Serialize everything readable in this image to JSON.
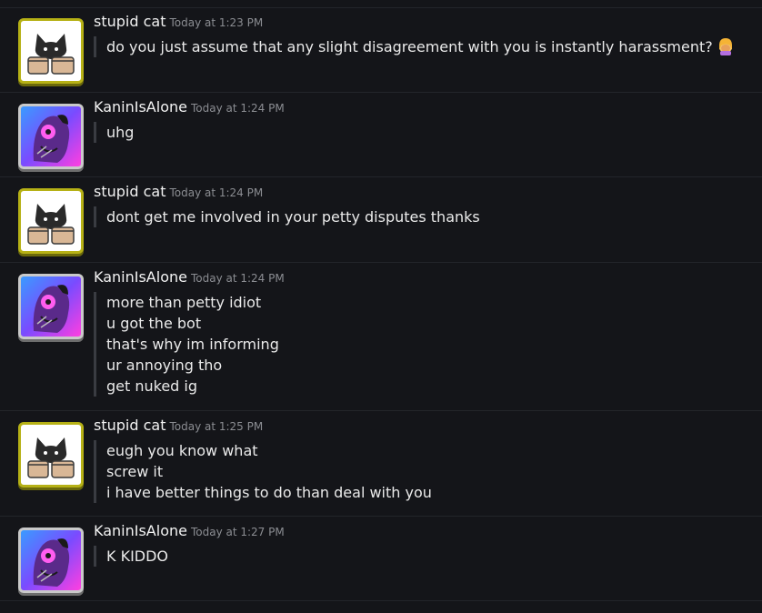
{
  "messages": [
    {
      "username": "stupid cat",
      "timestamp": "Today at 1:23 PM",
      "avatar": "cat-avatar",
      "lines": [
        "do you just assume that any slight disagreement with you is instantly harassment?"
      ],
      "emoji": "facepalm-emoji"
    },
    {
      "username": "KaninIsAlone",
      "timestamp": "Today at 1:24 PM",
      "avatar": "kanin-avatar",
      "lines": [
        "uhg"
      ]
    },
    {
      "username": "stupid cat",
      "timestamp": "Today at 1:24 PM",
      "avatar": "cat-avatar",
      "lines": [
        "dont get me involved in your petty disputes thanks"
      ]
    },
    {
      "username": "KaninIsAlone",
      "timestamp": "Today at 1:24 PM",
      "avatar": "kanin-avatar",
      "lines": [
        "more than petty idiot",
        "u got the bot",
        "that's why im informing",
        "ur annoying tho",
        "get nuked ig"
      ]
    },
    {
      "username": "stupid cat",
      "timestamp": "Today at 1:25 PM",
      "avatar": "cat-avatar",
      "lines": [
        "eugh you know what",
        "screw it",
        "i have better things to do than deal with you"
      ]
    },
    {
      "username": "KaninIsAlone",
      "timestamp": "Today at 1:27 PM",
      "avatar": "kanin-avatar",
      "lines": [
        "K KIDDO"
      ]
    }
  ],
  "colors": {
    "background": "#141519",
    "divider": "#23252a",
    "quote_bar": "#3a3c42",
    "cat_avatar_border": "#b6b116",
    "kanin_avatar_border": "#c9c9c9"
  }
}
